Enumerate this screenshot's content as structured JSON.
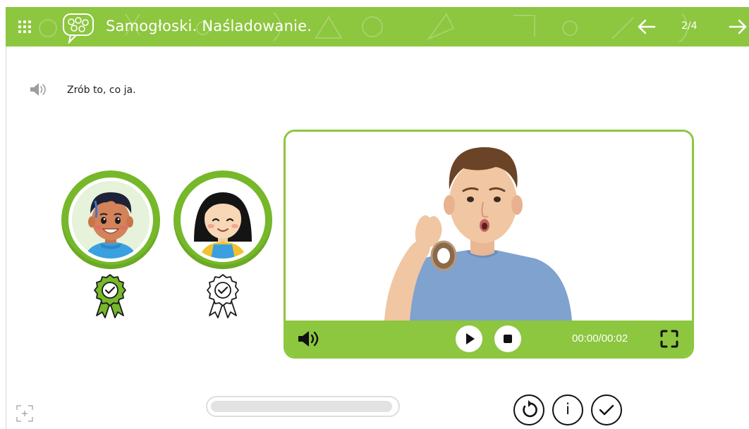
{
  "header": {
    "title": "Samogłoski. Naśladowanie.",
    "page_counter": "2/4",
    "background": "#8dc63f"
  },
  "icons": {
    "menu": "grid-menu-icon",
    "logo": "speech-bubble-logo-icon",
    "prev": "arrow-left-icon",
    "next": "arrow-right-icon",
    "speaker": "speaker-icon",
    "badge": "award-badge-icon",
    "fullscreen": "fullscreen-icon",
    "expand": "expand-icon",
    "reset": "reset-icon",
    "info": "info-icon",
    "check": "check-icon"
  },
  "instruction": {
    "text": "Zrób to, co ja."
  },
  "avatars": [
    {
      "character": "boy",
      "badge_color": "#76b82a",
      "completed": true
    },
    {
      "character": "girl",
      "badge_color": "#ffffff",
      "completed": true
    }
  ],
  "player": {
    "time": "00:00/00:02",
    "accent": "#8dc63f"
  },
  "progress": {
    "fraction": 0.97
  },
  "buttons": {
    "info_label": "i"
  }
}
